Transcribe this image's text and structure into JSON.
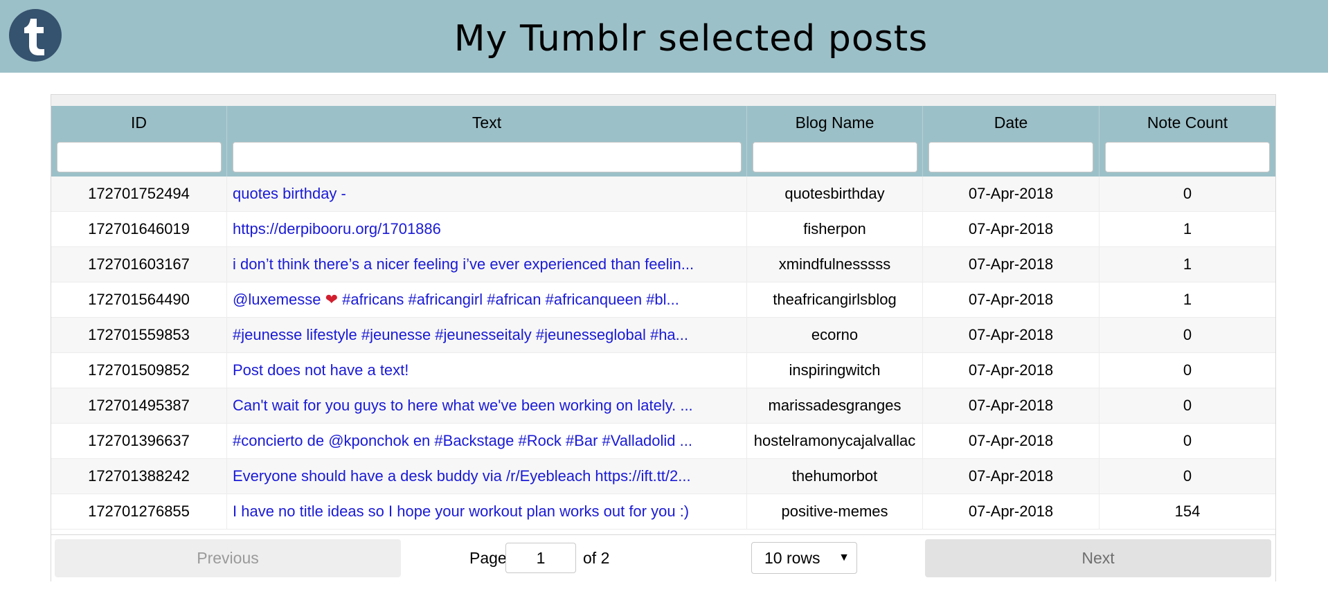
{
  "header": {
    "title": "My Tumblr selected posts",
    "logo_icon": "tumblr-logo-icon"
  },
  "table": {
    "columns": [
      "ID",
      "Text",
      "Blog Name",
      "Date",
      "Note Count"
    ],
    "rows": [
      {
        "id": "172701752494",
        "text": "quotes birthday -",
        "blog": "quotesbirthday",
        "date": "07-Apr-2018",
        "notes": "0"
      },
      {
        "id": "172701646019",
        "text": "https://derpibooru.org/1701886",
        "blog": "fisherpon",
        "date": "07-Apr-2018",
        "notes": "1"
      },
      {
        "id": "172701603167",
        "text": "i don’t think there’s a nicer feeling i’ve ever experienced than feelin...",
        "blog": "xmindfulnesssss",
        "date": "07-Apr-2018",
        "notes": "1"
      },
      {
        "id": "172701564490",
        "text_pre": "@luxemesse ",
        "text_post": " #africans #africangirl #african #africanqueen #bl...",
        "emoji": "❤",
        "blog": "theafricangirlsblog",
        "date": "07-Apr-2018",
        "notes": "1"
      },
      {
        "id": "172701559853",
        "text": "#jeunesse lifestyle #jeunesse #jeunesseitaly #jeunesseglobal #ha...",
        "blog": "ecorno",
        "date": "07-Apr-2018",
        "notes": "0"
      },
      {
        "id": "172701509852",
        "text": "Post does not have a text!",
        "blog": "inspiringwitch",
        "date": "07-Apr-2018",
        "notes": "0"
      },
      {
        "id": "172701495387",
        "text": "Can't wait for you guys to here what we've been working on lately. ...",
        "blog": "marissadesgranges",
        "date": "07-Apr-2018",
        "notes": "0"
      },
      {
        "id": "172701396637",
        "text": "#concierto de @kponchok en #Backstage #Rock #Bar #Valladolid ...",
        "blog": "hostelramonycajalvallac",
        "date": "07-Apr-2018",
        "notes": "0"
      },
      {
        "id": "172701388242",
        "text": "Everyone should have a desk buddy via /r/Eyebleach https://ift.tt/2...",
        "blog": "thehumorbot",
        "date": "07-Apr-2018",
        "notes": "0"
      },
      {
        "id": "172701276855",
        "text": "I have no title ideas so I hope your workout plan works out for you :)",
        "blog": "positive-memes",
        "date": "07-Apr-2018",
        "notes": "154"
      }
    ]
  },
  "pagination": {
    "previous_label": "Previous",
    "next_label": "Next",
    "page_label": "Page",
    "page_value": "1",
    "of_label": "of 2",
    "rows_label": "10 rows",
    "rows_caret": "▼"
  },
  "colors": {
    "header_bg": "#9cc0c8",
    "link": "#1a1ad6",
    "logo_bg": "#35526e"
  }
}
